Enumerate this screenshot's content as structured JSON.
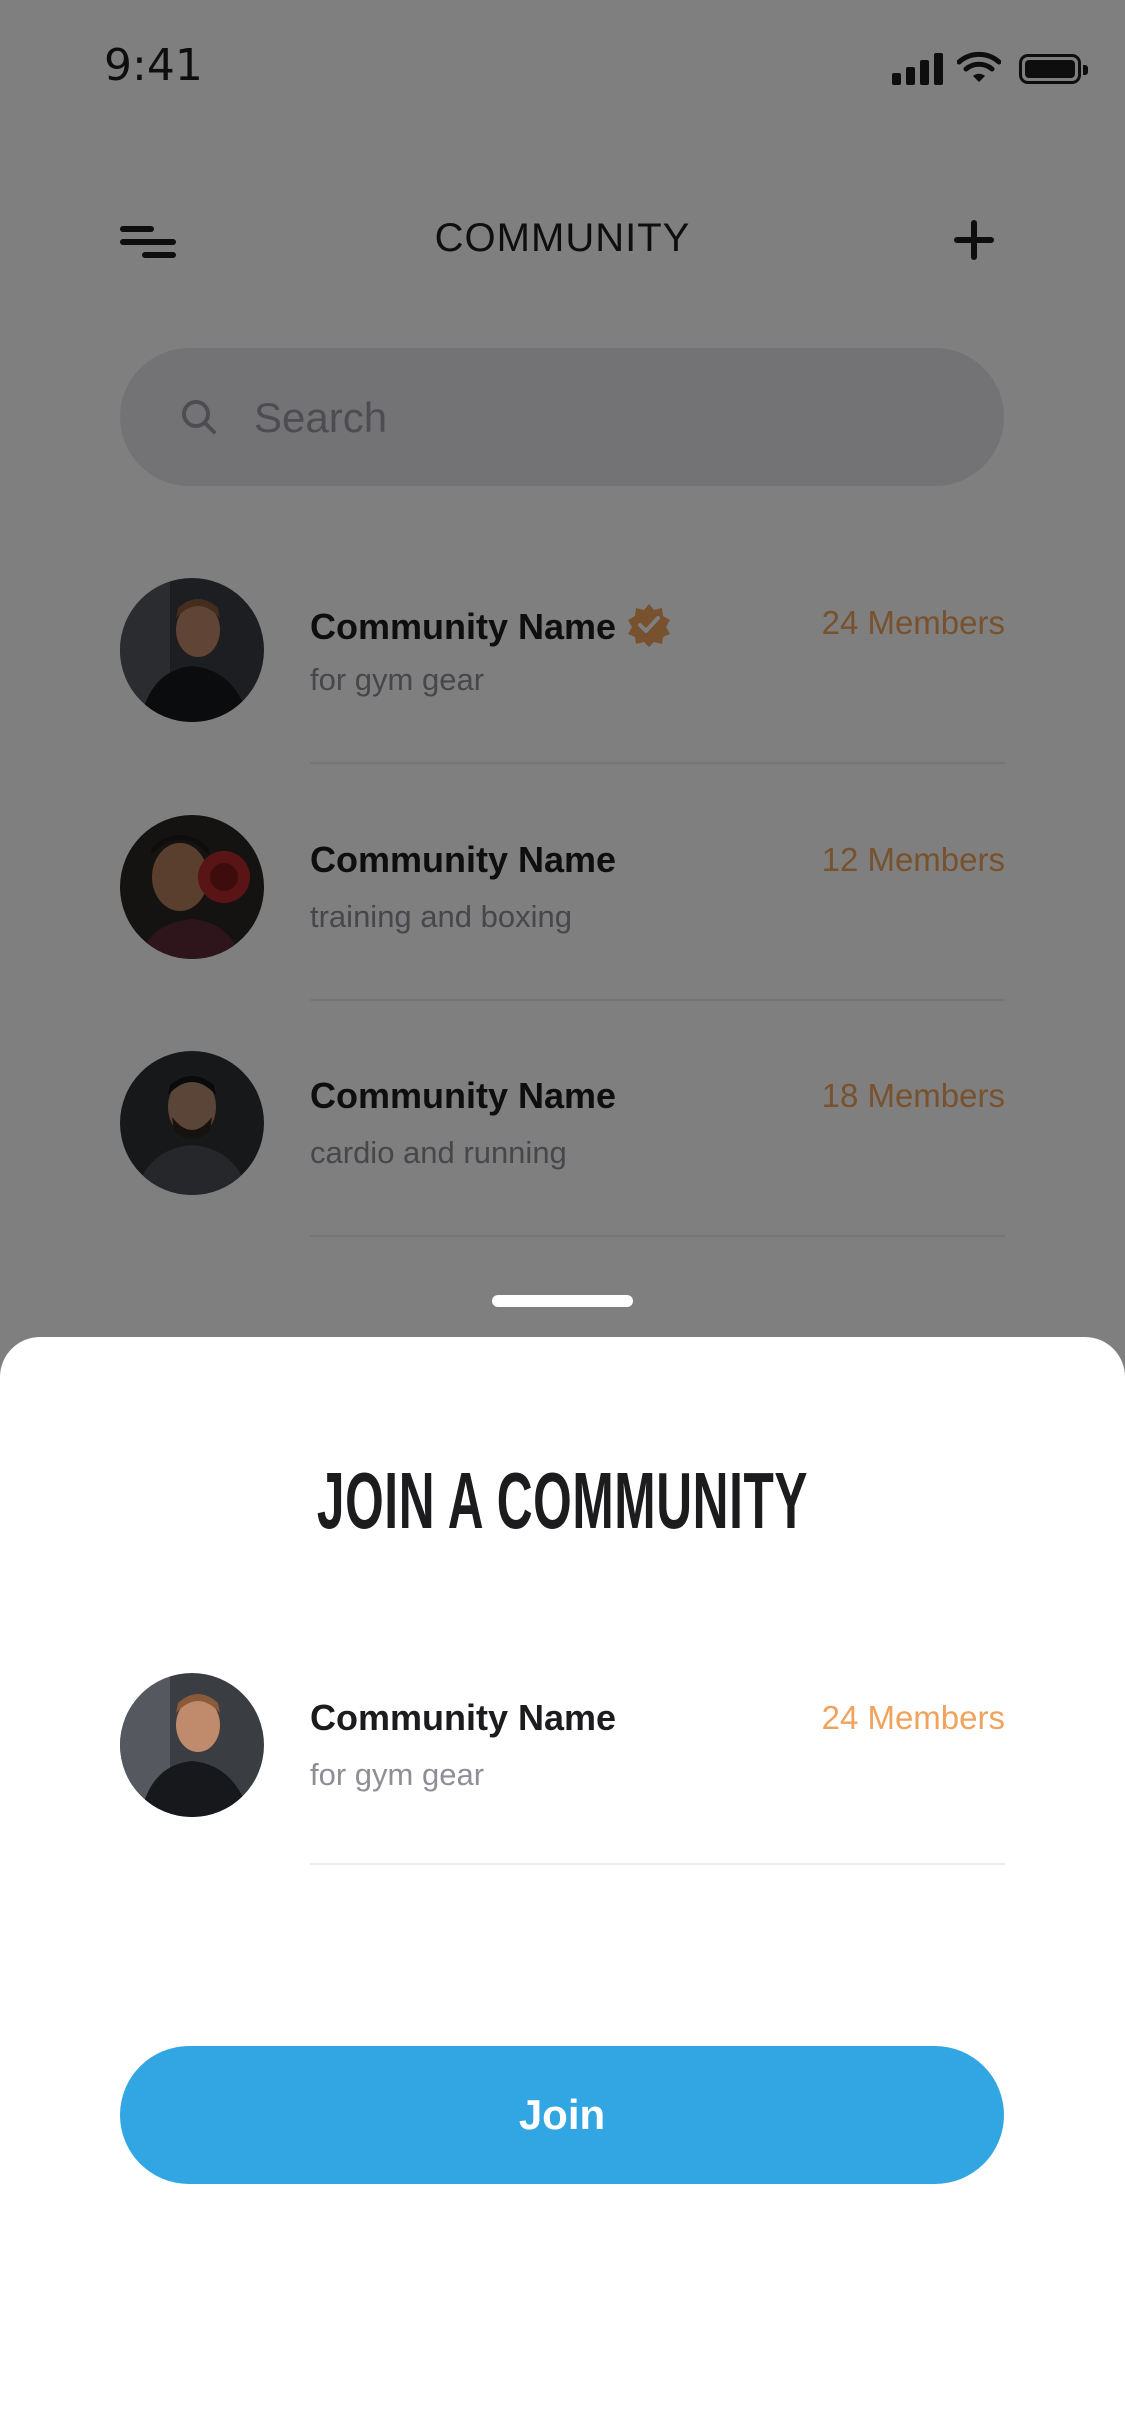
{
  "status_bar": {
    "time": "9:41",
    "icons": [
      "signal-icon",
      "wifi-icon",
      "battery-icon"
    ]
  },
  "header": {
    "title": "COMMUNITY",
    "menu_icon": "menu-icon",
    "add_icon": "add-icon"
  },
  "search": {
    "placeholder": "Search",
    "value": ""
  },
  "communities": [
    {
      "name": "Community Name",
      "description": "for gym gear",
      "members": "24 Members",
      "verified": true
    },
    {
      "name": "Community Name",
      "description": "training and boxing",
      "members": "12 Members",
      "verified": false
    },
    {
      "name": "Community Name",
      "description": "cardio and running",
      "members": "18 Members",
      "verified": false
    }
  ],
  "sheet": {
    "title": "JOIN A COMMUNITY",
    "community": {
      "name": "Community Name",
      "description": "for gym gear",
      "members": "24 Members"
    },
    "join_label": "Join"
  },
  "colors": {
    "accent": "#32a6e2",
    "members": "#f0a35c",
    "verified_badge": "#f0a35c",
    "text": "#1c1c1e",
    "muted": "#8e8e96"
  }
}
